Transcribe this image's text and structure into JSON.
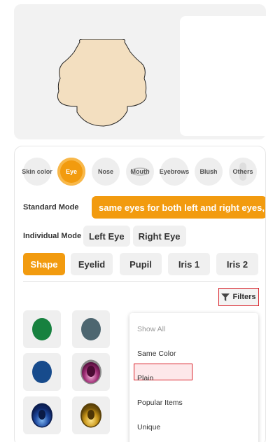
{
  "categories": [
    {
      "label": "Skin color",
      "active": false
    },
    {
      "label": "Eye",
      "active": true
    },
    {
      "label": "Nose",
      "active": false
    },
    {
      "label": "Mouth",
      "active": false
    },
    {
      "label": "Eyebrows",
      "active": false
    },
    {
      "label": "Blush",
      "active": false
    },
    {
      "label": "Others",
      "active": false
    }
  ],
  "modes": {
    "standard_label": "Standard Mode",
    "standard_banner": "same eyes for both left and right eyes,",
    "individual_label": "Individual Mode",
    "left_eye": "Left Eye",
    "right_eye": "Right Eye"
  },
  "tabs": [
    {
      "label": "Shape",
      "active": true
    },
    {
      "label": "Eyelid",
      "active": false
    },
    {
      "label": "Pupil",
      "active": false
    },
    {
      "label": "Iris 1",
      "active": false
    },
    {
      "label": "Iris 2",
      "active": false
    }
  ],
  "filters": {
    "label": "Filters",
    "options": [
      "Show All",
      "Same Color",
      "Plain",
      "Popular Items",
      "Unique"
    ],
    "selected": "Plain"
  },
  "items": [
    {
      "name": "green-eye",
      "color": "#17813f"
    },
    {
      "name": "slate-eye",
      "color": "#4d6670"
    },
    {
      "name": "navy-eye",
      "color": "#174b8c"
    },
    {
      "name": "magenta-eye",
      "color": "#7d1e5a"
    },
    {
      "name": "blue-gradient-eye",
      "color": "#1b3d86"
    },
    {
      "name": "gold-eye",
      "color": "#b48a1a"
    }
  ],
  "colors": {
    "accent": "#f29b0f",
    "highlight": "#d9222a",
    "skin": "#f3dfc0"
  }
}
